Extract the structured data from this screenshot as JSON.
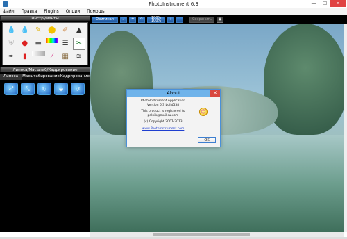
{
  "window": {
    "title": "PhotoInstrument 6.3",
    "controls": [
      "minimize-icon",
      "maximize-icon",
      "close-icon"
    ]
  },
  "menu": [
    "Файл",
    "Правка",
    "Plugins",
    "Опции",
    "Помощь"
  ],
  "left_panel": {
    "tools_header": "Инструменты",
    "tools": [
      "drop-icon",
      "droplet-icon",
      "pencil-icon",
      "stamp-icon",
      "brush-icon",
      "stamp-dark-icon",
      "shield-icon",
      "red-dot-icon",
      "eraser-icon",
      "spectrum-icon",
      "lines-icon",
      "selected-tool-icon",
      "pen-icon",
      "red-pencil-icon",
      "gradient-icon",
      "wand-icon",
      "film-icon",
      "stack-icon"
    ],
    "section_header": "Липоса/Масштаб/Кадрирование",
    "tabs": [
      "Липоса",
      "Масштабирование",
      "Кадрирование"
    ],
    "subtools": [
      "liposa-tool-1",
      "liposa-tool-2",
      "liposa-tool-3",
      "liposa-tool-4",
      "liposa-tool-5"
    ]
  },
  "toolbar": {
    "original_label": "Оригинал",
    "zoom_label_top": "100%",
    "zoom_label_bottom": "100%",
    "save_label": "Сохранить"
  },
  "about_dialog": {
    "title": "About",
    "lines": [
      "PhotoInstrument Application",
      "Version 6.3 build538"
    ],
    "registered": [
      "This product is registered to",
      "palnik@mail.ru.com"
    ],
    "copyright": "(c) Copyright 2007-2013",
    "website": "www.PhotoInstrument.com",
    "ok_label": "OK"
  },
  "colors": {
    "accent": "#3f88d8",
    "panel_bg": "#000000",
    "dialog_title": "#6fb3ea",
    "close_red": "#e04343"
  }
}
